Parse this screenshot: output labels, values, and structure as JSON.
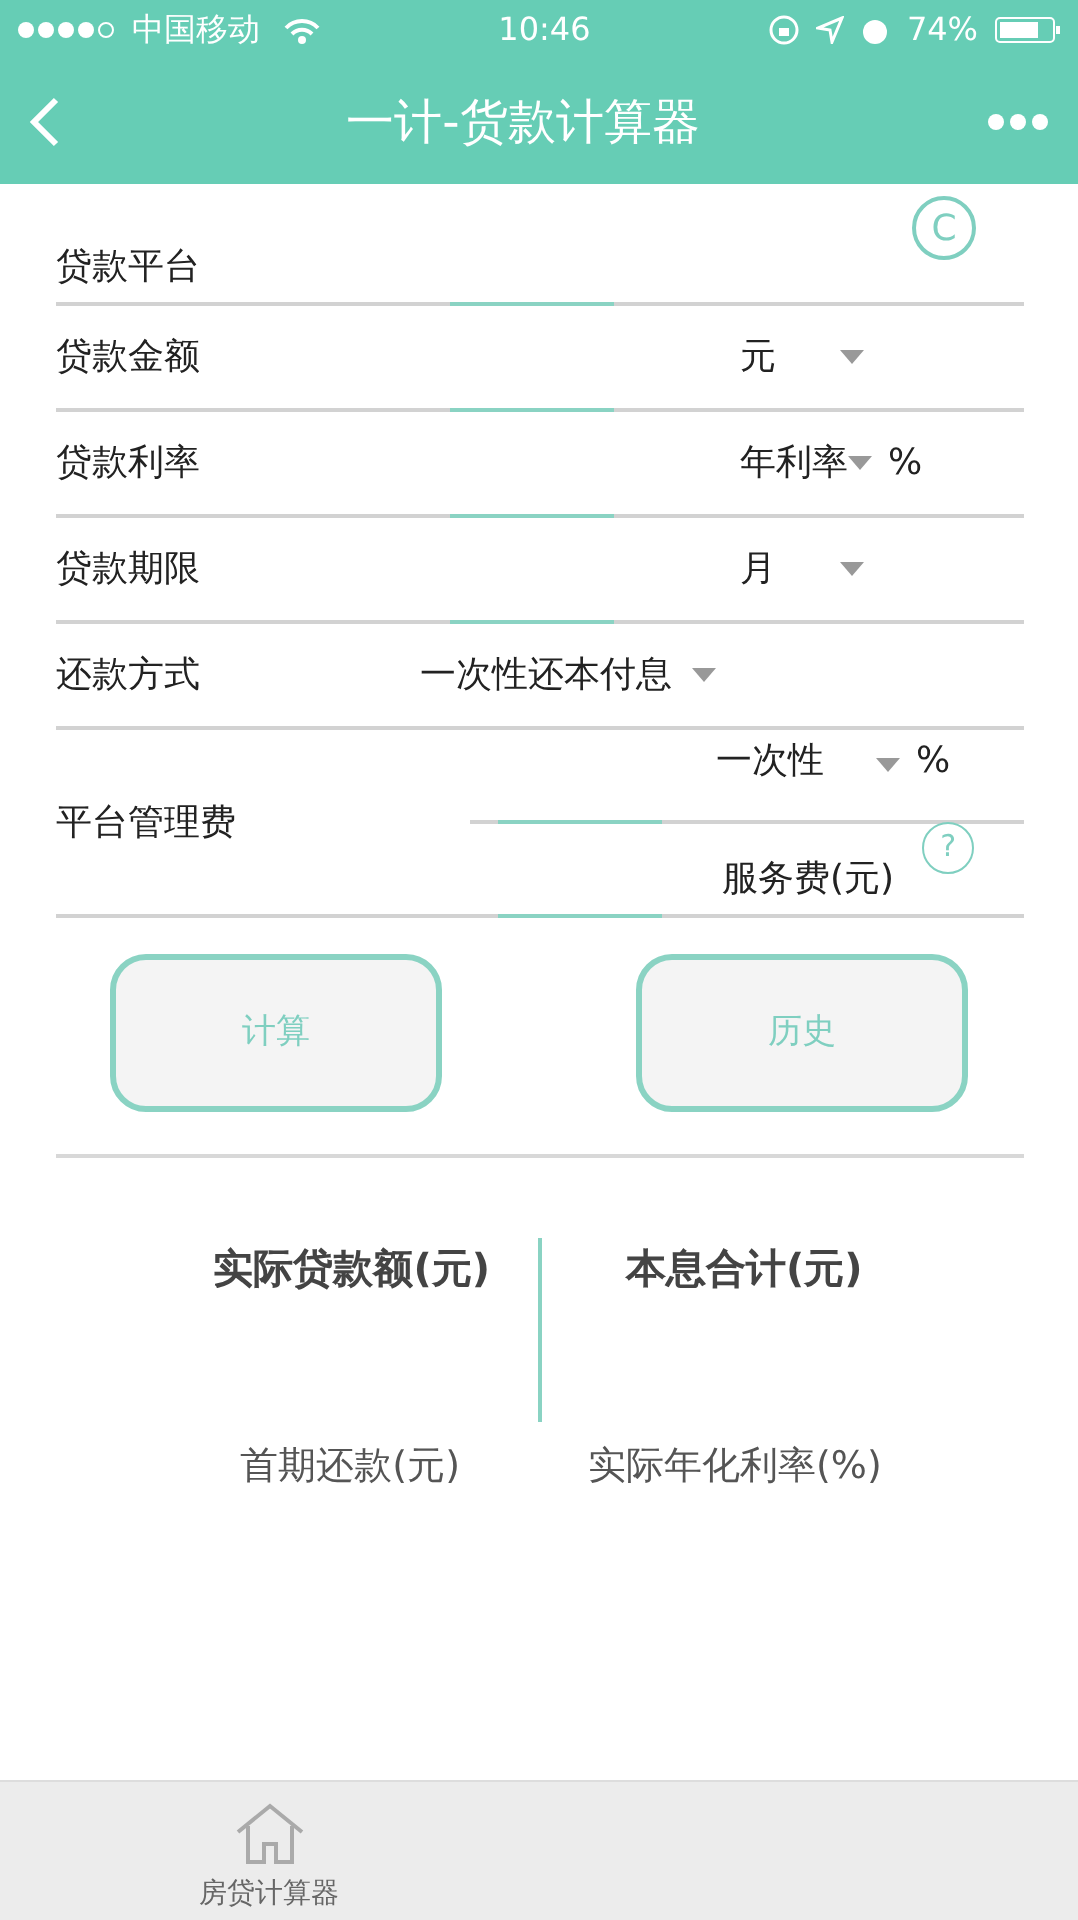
{
  "status_bar": {
    "carrier": "中国移动",
    "time": "10:46",
    "battery": "74%"
  },
  "title": "一计-货款计算器",
  "rows": [
    {
      "kind": "input",
      "label": "贷款平台",
      "action": "C"
    },
    {
      "kind": "unit",
      "label": "贷款金额",
      "unit": "元"
    },
    {
      "kind": "unit",
      "label": "贷款利率",
      "unit": "年利率",
      "suffix": "%"
    },
    {
      "kind": "unit",
      "label": "贷款期限",
      "unit": "月"
    },
    {
      "kind": "select",
      "label": "还款方式",
      "value": "一次性还本付息"
    },
    {
      "kind": "fee",
      "label": "平台管理费",
      "unit": "一次性",
      "suffix": "%",
      "second_label": "服务费(元)",
      "help": "?"
    }
  ],
  "buttons": [
    "计算",
    "历史"
  ],
  "results": [
    {
      "label": "实际贷款额(元)",
      "kind": "major"
    },
    {
      "label": "本息合计(元)",
      "kind": "major"
    },
    {
      "label": "首期还款(元)",
      "kind": "minor"
    },
    {
      "label": "实际年化利率(%)",
      "kind": "minor"
    }
  ],
  "tab_bar": [
    {
      "label": "房贷计算器",
      "selected": false
    }
  ]
}
